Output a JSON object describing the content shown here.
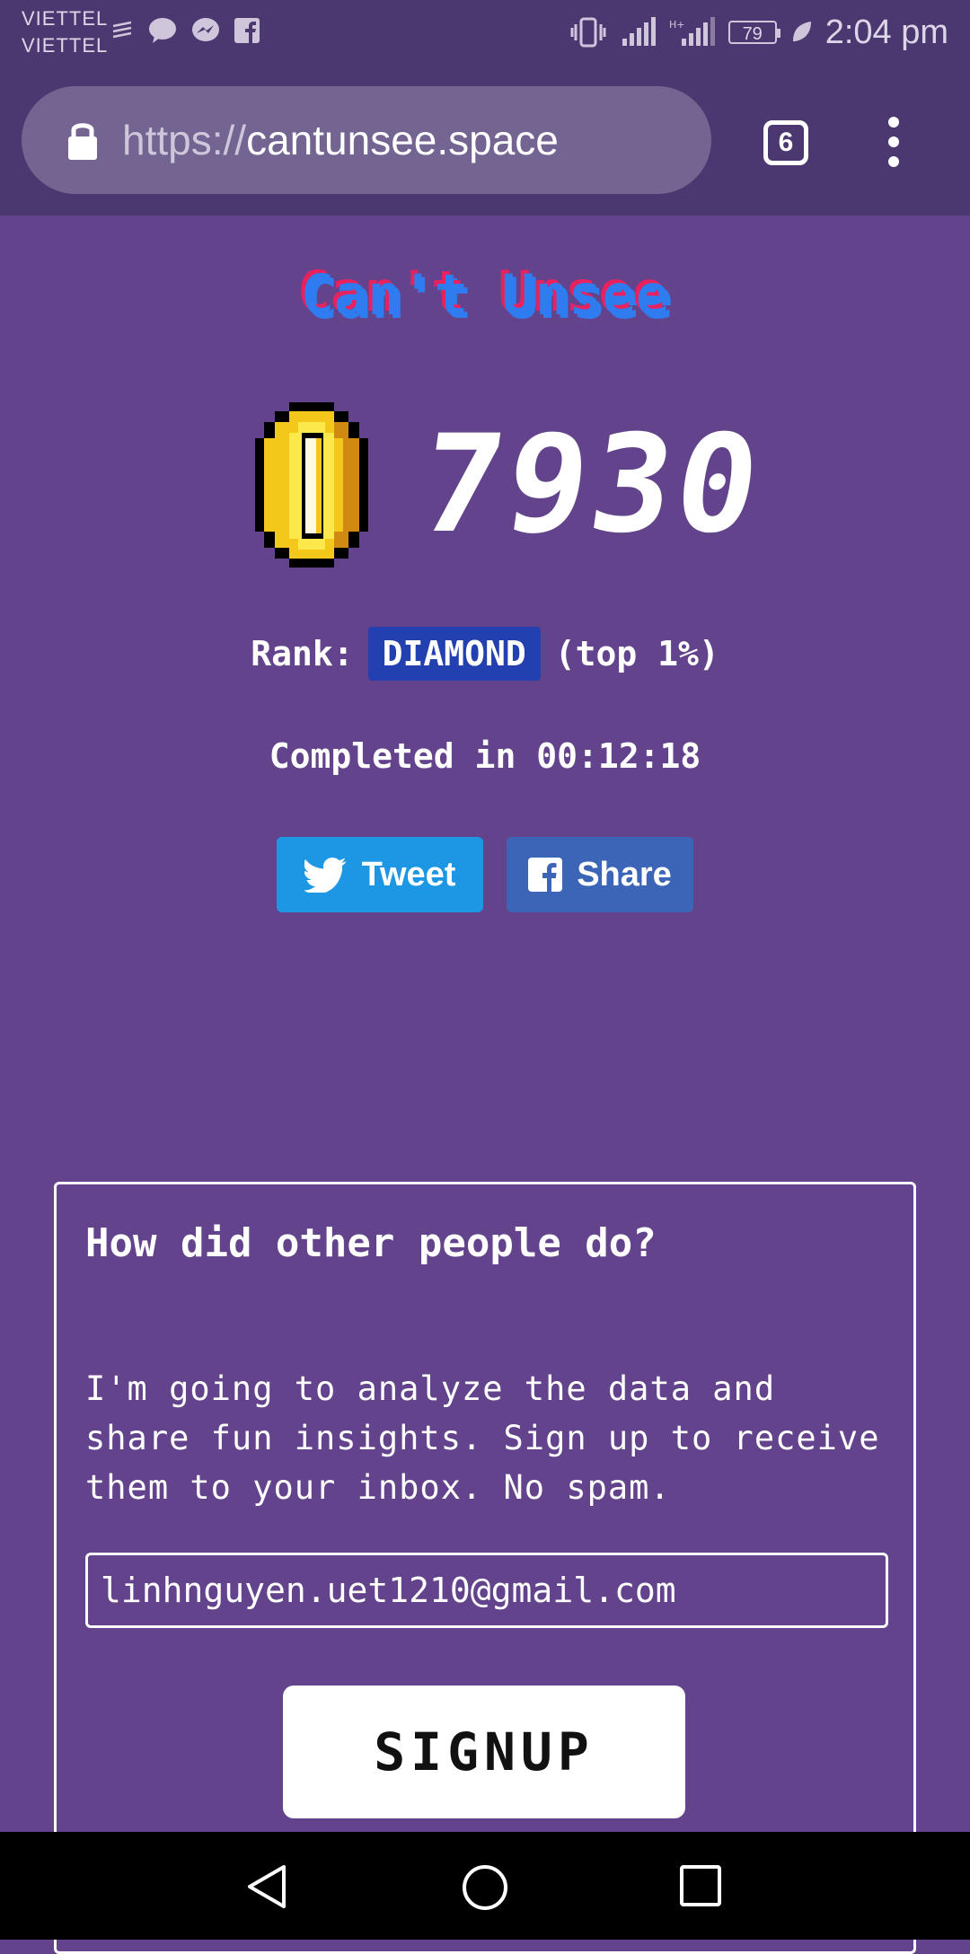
{
  "status_bar": {
    "carrier_1": "VIETTEL",
    "carrier_2": "VIETTEL",
    "battery": "79",
    "time": "2:04 pm"
  },
  "browser": {
    "url_scheme": "https://",
    "url_host": "cantunsee.space",
    "tab_count": "6"
  },
  "page": {
    "title": "Can't Unsee",
    "score": "7930",
    "rank_label": "Rank:",
    "rank_value": "DIAMOND",
    "rank_suffix": "(top 1%)",
    "completed_text": "Completed in 00:12:18",
    "tweet_label": "Tweet",
    "share_label": "Share"
  },
  "signup_card": {
    "heading": "How did other people do?",
    "body": "I'm going to analyze the data and share fun insights. Sign up to receive them to your inbox. No spam.",
    "email_value": "linhnguyen.uet1210@gmail.com",
    "button_label": "SIGNUP"
  },
  "colors": {
    "background": "#63448c",
    "rank_badge": "#2340b0",
    "tweet": "#1d96e4",
    "share": "#3d65b7"
  }
}
